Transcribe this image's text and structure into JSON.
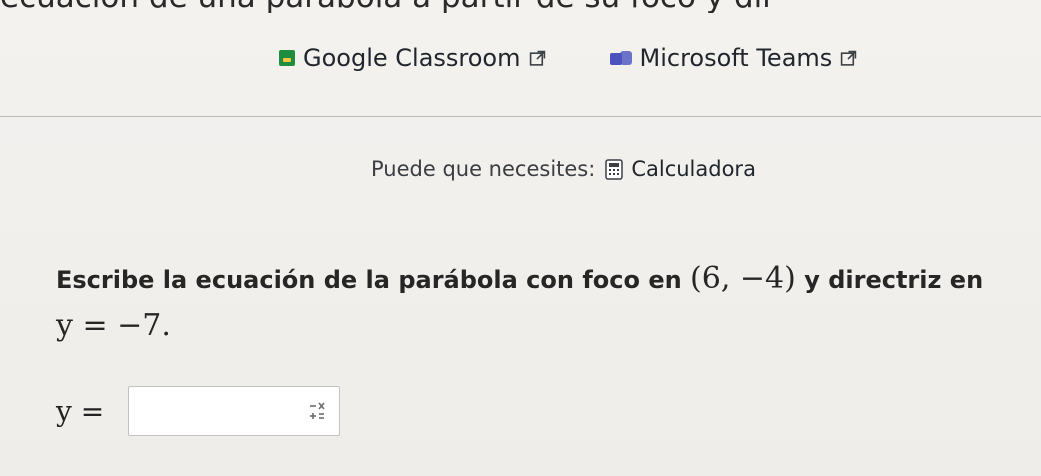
{
  "header": {
    "top_cut_text": "ecuación de una parábola a partir de su foco y dir"
  },
  "links": [
    {
      "label": "Google Classroom"
    },
    {
      "label": "Microsoft Teams"
    }
  ],
  "tools": {
    "prefix": "Puede que necesites:",
    "calculator_label": "Calculadora"
  },
  "question": {
    "text_before": "Escribe la ecuación de la parábola con foco en ",
    "focus": "(6, −4)",
    "text_middle": " y directriz en ",
    "directrix": "y = −7",
    "text_end": "."
  },
  "answer": {
    "label": "y =",
    "value": ""
  }
}
